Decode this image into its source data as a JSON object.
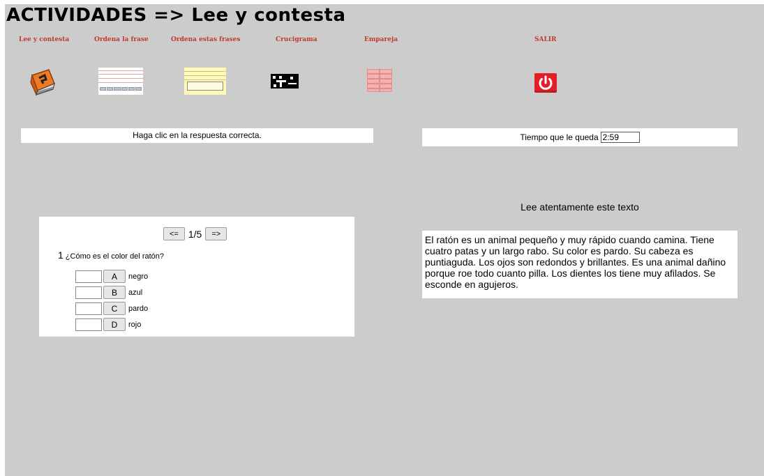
{
  "header": {
    "title": "ACTIVIDADES => Lee y contesta"
  },
  "nav": {
    "items": [
      {
        "label": "Lee y contesta",
        "icon": "book-icon"
      },
      {
        "label": "Ordena la frase",
        "icon": "lines-thumbnail-icon"
      },
      {
        "label": "Ordena estas frases",
        "icon": "yellow-lines-thumbnail-icon"
      },
      {
        "label": "Crucigrama",
        "icon": "crossword-icon"
      },
      {
        "label": "Empareja",
        "icon": "match-grid-icon"
      },
      {
        "label": "SALIR",
        "icon": "power-icon"
      }
    ]
  },
  "instructions": "Haga clic en la respuesta correcta.",
  "timer": {
    "label": "Tiempo que le queda",
    "value": "2:59"
  },
  "quiz": {
    "prev_label": "<=",
    "next_label": "=>",
    "counter": "1/5",
    "question_number": "1",
    "question": "¿Cómo es el color del ratón?",
    "options": [
      {
        "letter": "A",
        "text": "negro"
      },
      {
        "letter": "B",
        "text": "azul"
      },
      {
        "letter": "C",
        "text": "pardo"
      },
      {
        "letter": "D",
        "text": "rojo"
      }
    ]
  },
  "reading": {
    "title": "Lee atentamente este texto",
    "text": "El ratón es un animal pequeño y muy rápido cuando camina. Tiene cuatro patas y un largo rabo. Su color es pardo. Su cabeza es puntiaguda. Los ojos son redondos y brillantes. Es una animal dañino porque roe todo cuanto pilla. Los dientes los tiene muy afilados. Se esconde en agujeros."
  },
  "colors": {
    "background": "#cccccc",
    "nav_label": "#c0392b",
    "exit_button": "#e21f26"
  }
}
